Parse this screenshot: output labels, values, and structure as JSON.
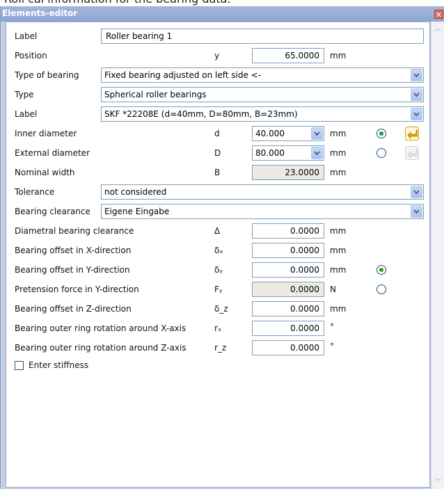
{
  "caption": "Roll cal information for the bearing data.",
  "window": {
    "title": "Elements-editor",
    "close": "✕"
  },
  "fields": {
    "label": {
      "label": "Label",
      "value": "Roller bearing 1"
    },
    "position": {
      "label": "Position",
      "symbol": "y",
      "value": "65.0000",
      "unit": "mm"
    },
    "type_of_bearing": {
      "label": "Type of bearing",
      "value": "Fixed bearing adjusted on left side <-"
    },
    "type": {
      "label": "Type",
      "value": "Spherical roller bearings"
    },
    "catalog_label": {
      "label": "Label",
      "value": "SKF *22208E (d=40mm, D=80mm, B=23mm)"
    },
    "inner_diameter": {
      "label": "Inner diameter",
      "symbol": "d",
      "value": "40.000",
      "unit": "mm",
      "selected": true
    },
    "external_diameter": {
      "label": "External diameter",
      "symbol": "D",
      "value": "80.000",
      "unit": "mm",
      "selected": false
    },
    "nominal_width": {
      "label": "Nominal width",
      "symbol": "B",
      "value": "23.0000",
      "unit": "mm"
    },
    "tolerance": {
      "label": "Tolerance",
      "value": "not considered"
    },
    "bearing_clearance": {
      "label": "Bearing clearance",
      "value": "Eigene Eingabe"
    },
    "diametral_clearance": {
      "label": "Diametral bearing clearance",
      "symbol": "Δ",
      "value": "0.0000",
      "unit": "mm"
    },
    "offset_x": {
      "label": "Bearing offset in X-direction",
      "symbol": "δₓ",
      "value": "0.0000",
      "unit": "mm"
    },
    "offset_y": {
      "label": "Bearing offset in Y-direction",
      "symbol": "δᵧ",
      "value": "0.0000",
      "unit": "mm",
      "selected": true
    },
    "pretension_y": {
      "label": "Pretension force in Y-direction",
      "symbol": "Fᵧ",
      "value": "0.0000",
      "unit": "N",
      "selected": false
    },
    "offset_z": {
      "label": "Bearing offset in Z-direction",
      "symbol": "δ_z",
      "value": "0.0000",
      "unit": "mm"
    },
    "rotation_x": {
      "label": "Bearing outer ring rotation around X-axis",
      "symbol": "rₓ",
      "value": "0.0000",
      "unit": "°"
    },
    "rotation_z": {
      "label": "Bearing outer ring rotation around Z-axis",
      "symbol": "r_z",
      "value": "0.0000",
      "unit": "°"
    },
    "stiffness": {
      "label": "Enter stiffness",
      "checked": false
    }
  },
  "colors": {
    "titlebar": "#8ea6d2",
    "field_border": "#7f9db9",
    "readonly_bg": "#ebebe4",
    "radio_dot": "#21a121",
    "apply_icon": "#e0a800"
  },
  "icons": [
    "close-icon",
    "dropdown-arrow-icon",
    "apply-arrow-icon",
    "scroll-up-icon",
    "scroll-down-icon"
  ]
}
